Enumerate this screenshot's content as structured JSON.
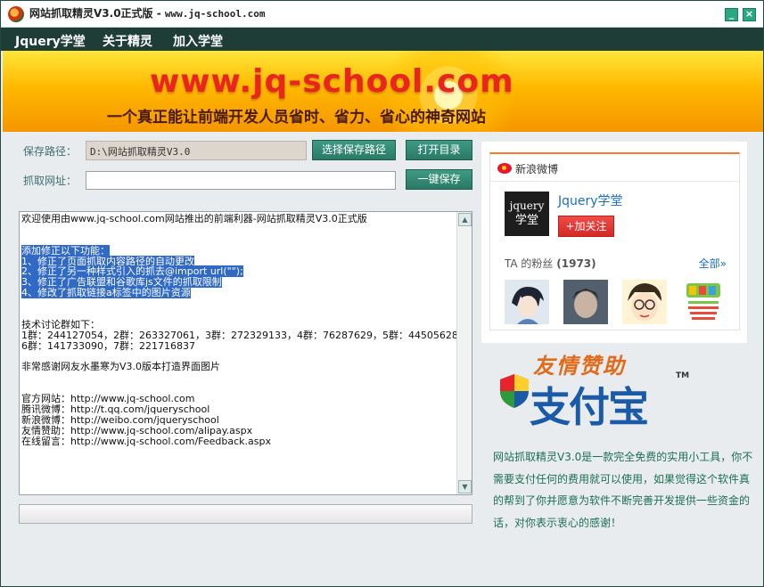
{
  "window": {
    "title": "网站抓取精灵V3.0正式版 - ",
    "title_url": "www.jq-school.com",
    "minimize": "_",
    "close": "×"
  },
  "menu": [
    "Jquery学堂",
    "关于精灵",
    "加入学堂"
  ],
  "banner": {
    "url": "www.jq-school.com",
    "slogan": "一个真正能让前端开发人员省时、省力、省心的神奇网站"
  },
  "form": {
    "save_path_label": "保存路径：",
    "save_path_value": "D:\\网站抓取精灵V3.0",
    "choose_path_button": "选择保存路径",
    "open_dir_button": "打开目录",
    "fetch_url_label": "抓取网址：",
    "fetch_url_value": "",
    "one_click_save_button": "一键保存"
  },
  "log": {
    "lines": [
      {
        "text": "欢迎使用由www.jq-school.com网站推出的前端利器-网站抓取精灵V3.0正式版",
        "selected": false
      },
      {
        "text": "",
        "selected": false
      },
      {
        "text": "",
        "selected": false
      },
      {
        "text": "添加修正以下功能：",
        "selected": true
      },
      {
        "text": "1、修正了页面抓取内容路径的自动更改",
        "selected": true
      },
      {
        "text": "2、修正了另一种样式引入的抓去@import url(\"\");",
        "selected": true
      },
      {
        "text": "3、修正了广告联盟和谷歌库js文件的抓取限制",
        "selected": true
      },
      {
        "text": "4、修改了抓取链接a标签中的图片资源",
        "selected": true
      },
      {
        "text": "",
        "selected": false
      },
      {
        "text": "",
        "selected": false
      },
      {
        "text": "技术讨论群如下：",
        "selected": false
      },
      {
        "text": "1群：244127054，2群：263327061，3群：272329133，4群：76287629，5群：44505628",
        "selected": false
      },
      {
        "text": "6群：141733090，7群：221716837",
        "selected": false
      },
      {
        "text": "",
        "selected": false
      },
      {
        "text": "非常感谢网友水墨寒为V3.0版本打造界面图片",
        "selected": false
      },
      {
        "text": "",
        "selected": false
      },
      {
        "text": "",
        "selected": false
      },
      {
        "text": "官方网站：http://www.jq-school.com",
        "selected": false
      },
      {
        "text": "腾讯微博：http://t.qq.com/jqueryschool",
        "selected": false
      },
      {
        "text": "新浪微博：http://weibo.com/jqueryschool",
        "selected": false
      },
      {
        "text": "友情赞助：http://www.jq-school.com/alipay.aspx",
        "selected": false
      },
      {
        "text": "在线留言：http://www.jq-school.com/Feedback.aspx",
        "selected": false
      }
    ]
  },
  "weibo": {
    "header": "新浪微博",
    "name": "Jquery学堂",
    "avatar_text": "Jquery\n学堂",
    "follow_button": "+加关注",
    "fans_label": "TA 的粉丝",
    "fans_count": "(1973)",
    "all_link": "全部»",
    "icon": "weibo-icon",
    "accent": "#e6162d"
  },
  "sponsor": {
    "title": "友情赞助",
    "logo": "支付宝",
    "tm": "TM",
    "text": "网站抓取精灵V3.0是一款完全免费的实用小工具，你不需要支付任何的费用就可以使用，如果觉得这个软件真的帮到了你并愿意为软件不断完善开发提供一些资金的话，对你表示衷心的感谢！"
  }
}
